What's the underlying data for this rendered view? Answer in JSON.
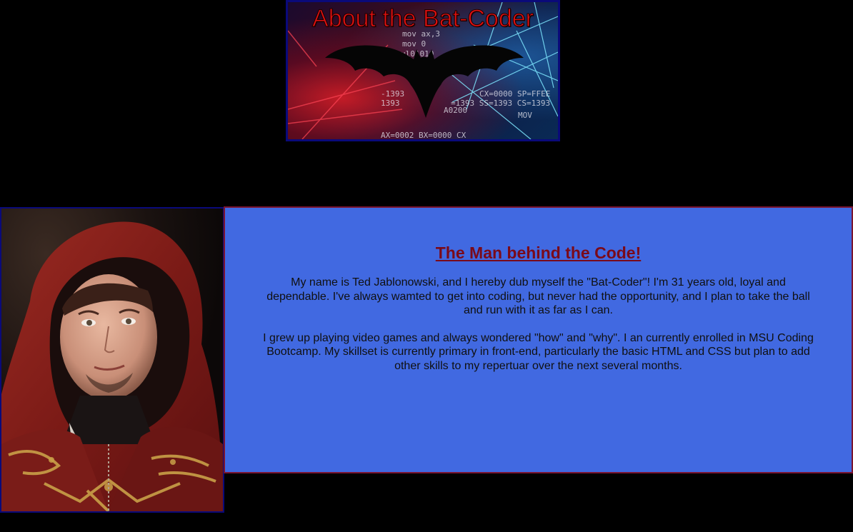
{
  "header": {
    "banner_title": "About the Bat-Coder"
  },
  "profile": {
    "photo_alt": ""
  },
  "about": {
    "heading": "The Man behind the Code!",
    "paragraph_1": "My name is Ted Jablonowski, and I hereby dub myself the \"Bat-Coder\"! I'm 31 years old, loyal and dependable. I've always wamted to get into coding, but never had the opportunity, and I plan to take the ball and run with it as far as I can.",
    "paragraph_2": "I grew up playing video games and always wondered \"how\" and \"why\". I an currently enrolled in MSU Coding Bootcamp. My skillset is currently primary in front-end, particularly the basic HTML and CSS but plan to add other skills to my repertuar over the next several months."
  },
  "colors": {
    "page_background": "#000000",
    "card_background": "#4169e1",
    "card_border": "#7a1430",
    "heading_color": "#7a0a1a",
    "banner_title_color": "#e01010",
    "frame_border": "#0a0a7a"
  },
  "icons": {
    "banner_emblem": "bat-logo-icon"
  }
}
